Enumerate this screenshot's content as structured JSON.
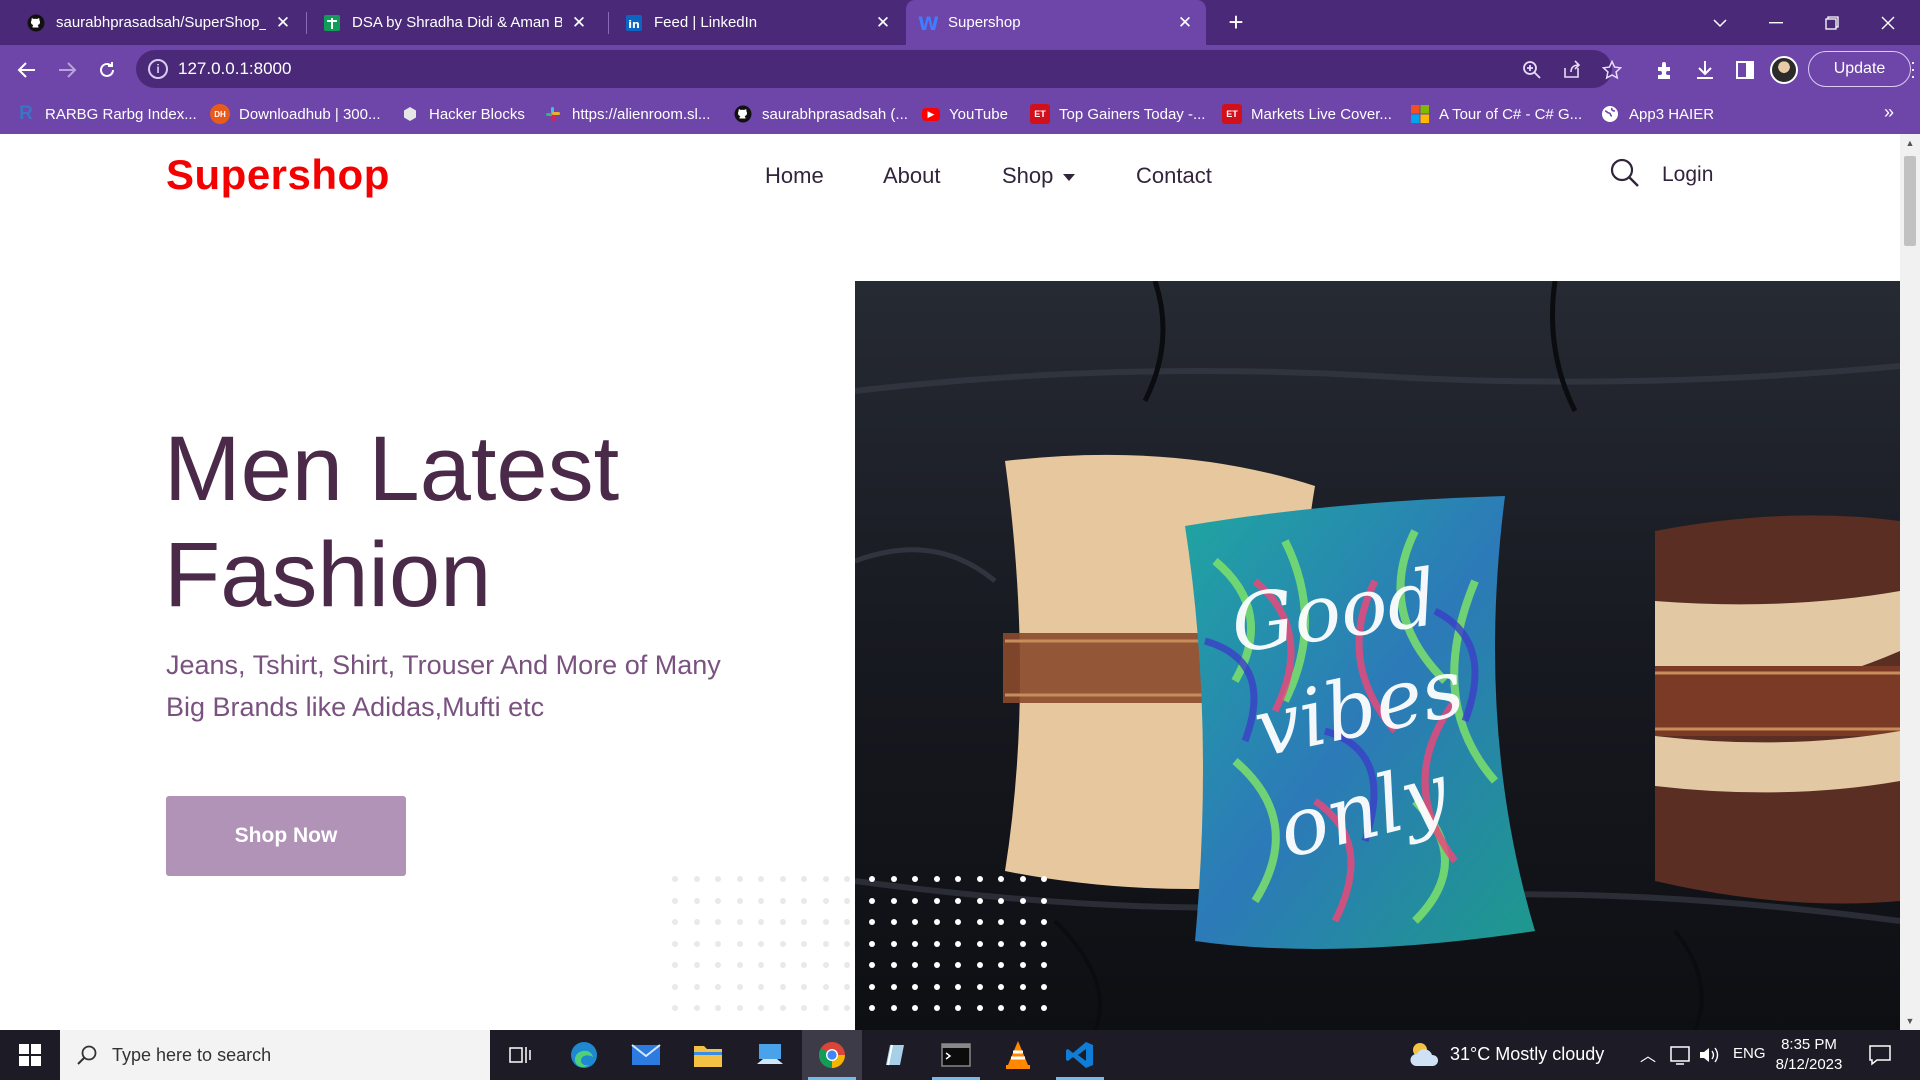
{
  "browser": {
    "tabs": [
      {
        "label": "saurabhprasadsah/SuperShop__D",
        "icon": "github-icon"
      },
      {
        "label": "DSA by Shradha Didi & Aman Bh",
        "icon": "sheets-icon"
      },
      {
        "label": "Feed | LinkedIn",
        "icon": "linkedin-icon"
      },
      {
        "label": "Supershop",
        "icon": "w-icon",
        "active": true
      }
    ],
    "url": "127.0.0.1:8000",
    "update_label": "Update",
    "bookmarks": [
      {
        "label": "RARBG Rarbg Index...",
        "icon_text": "R",
        "color": "#3a74c7"
      },
      {
        "label": "Downloadhub | 300...",
        "icon_text": "DH",
        "color": "#e85b1b"
      },
      {
        "label": "Hacker Blocks",
        "icon_text": "",
        "color": "#e6e6e6"
      },
      {
        "label": "https://alienroom.sl...",
        "icon_text": "",
        "color": "#36c5f0"
      },
      {
        "label": "saurabhprasadsah (...",
        "icon_text": "",
        "color": "#1a1a1a"
      },
      {
        "label": "YouTube",
        "icon_text": "▶",
        "color": "#ff0000"
      },
      {
        "label": "Top Gainers Today -...",
        "icon_text": "ET",
        "color": "#d0101b"
      },
      {
        "label": "Markets Live Cover...",
        "icon_text": "ET",
        "color": "#d0101b"
      },
      {
        "label": "A Tour of C# - C# G...",
        "icon_text": "",
        "color": "#f25022"
      },
      {
        "label": "App3 HAIER",
        "icon_text": "",
        "color": "#ffffff"
      }
    ]
  },
  "site": {
    "brand": "Supershop",
    "nav": [
      "Home",
      "About",
      "Shop",
      "Contact"
    ],
    "login": "Login",
    "hero": {
      "title_line1": "Men Latest",
      "title_line2": "Fashion",
      "subtitle_line1": "Jeans, Tshirt, Shirt, Trouser And More of Many",
      "subtitle_line2": "Big Brands like Adidas,Mufti etc",
      "cta": "Shop Now",
      "pillow_text": "Good vibes only"
    },
    "colors": {
      "brand": "#f40000",
      "heading": "#4a2a48",
      "cta": "#b193b8"
    }
  },
  "taskbar": {
    "search_placeholder": "Type here to search",
    "weather": "31°C  Mostly cloudy",
    "language": "ENG",
    "time": "8:35 PM",
    "date": "8/12/2023"
  }
}
